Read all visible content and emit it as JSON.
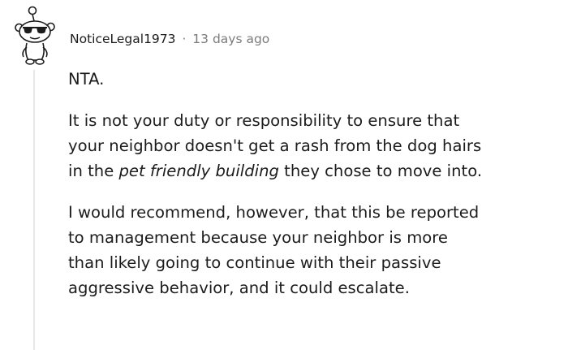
{
  "comment": {
    "avatar_icon": "reddit-snoo-sunglasses-icon",
    "username": "NoticeLegal1973",
    "separator": "·",
    "timestamp": "13 days ago",
    "paragraph1": "NTA.",
    "paragraph2": {
      "line1": "It is not your duty or responsibility to ensure that",
      "line2": "your neighbor doesn't get a rash from the dog hairs",
      "line3_before": "in the ",
      "line3_italic": "pet friendly building",
      "line3_after": " they chose to move into."
    },
    "paragraph3": {
      "line1": "I would recommend, however, that this be reported",
      "line2": "to management because your neighbor is more",
      "line3": "than likely going to continue with their passive",
      "line4": "aggressive behavior, and it could escalate."
    }
  },
  "colors": {
    "text": "#1c1c1c",
    "meta": "#7c7c7c",
    "thread_line": "#e6e8ea"
  }
}
